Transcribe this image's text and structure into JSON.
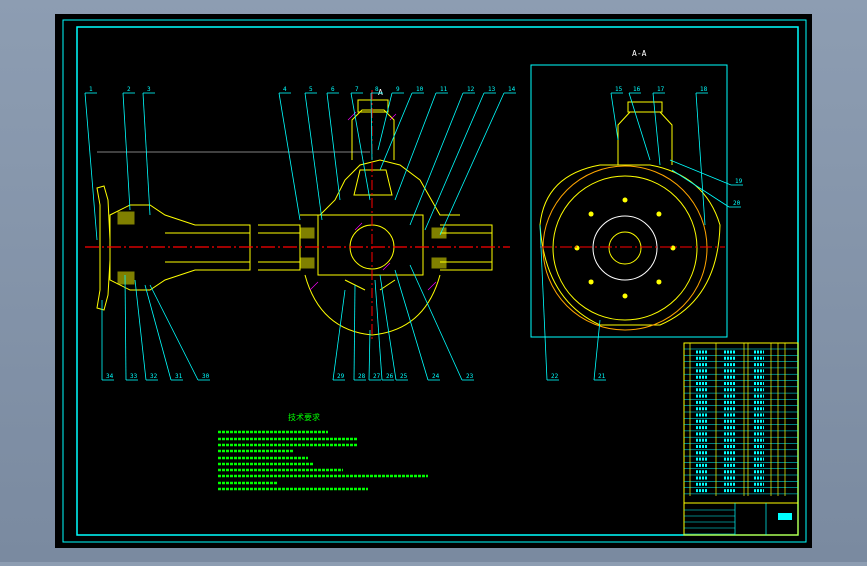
{
  "drawing": {
    "section_label": "A-A",
    "section_marker": "A",
    "tech_requirements_title": "技术要求",
    "balloons_top_main": [
      "1",
      "2",
      "3",
      "4",
      "5",
      "6",
      "7",
      "8",
      "9",
      "10",
      "11",
      "12",
      "13",
      "14"
    ],
    "balloons_bottom_main": [
      "34",
      "33",
      "32",
      "31",
      "30",
      "29",
      "28",
      "27",
      "26",
      "25",
      "24",
      "23"
    ],
    "balloons_side_top": [
      "15",
      "16",
      "17",
      "18"
    ],
    "balloons_side_right": [
      "19",
      "20"
    ],
    "balloons_side_bottom": [
      "22",
      "21"
    ]
  },
  "colors": {
    "canvas": "#000000",
    "border": "#00ffff",
    "outline": "#ffff00",
    "centerline": "#ff0000",
    "text": "#00ff00",
    "leader": "#00ffff"
  }
}
